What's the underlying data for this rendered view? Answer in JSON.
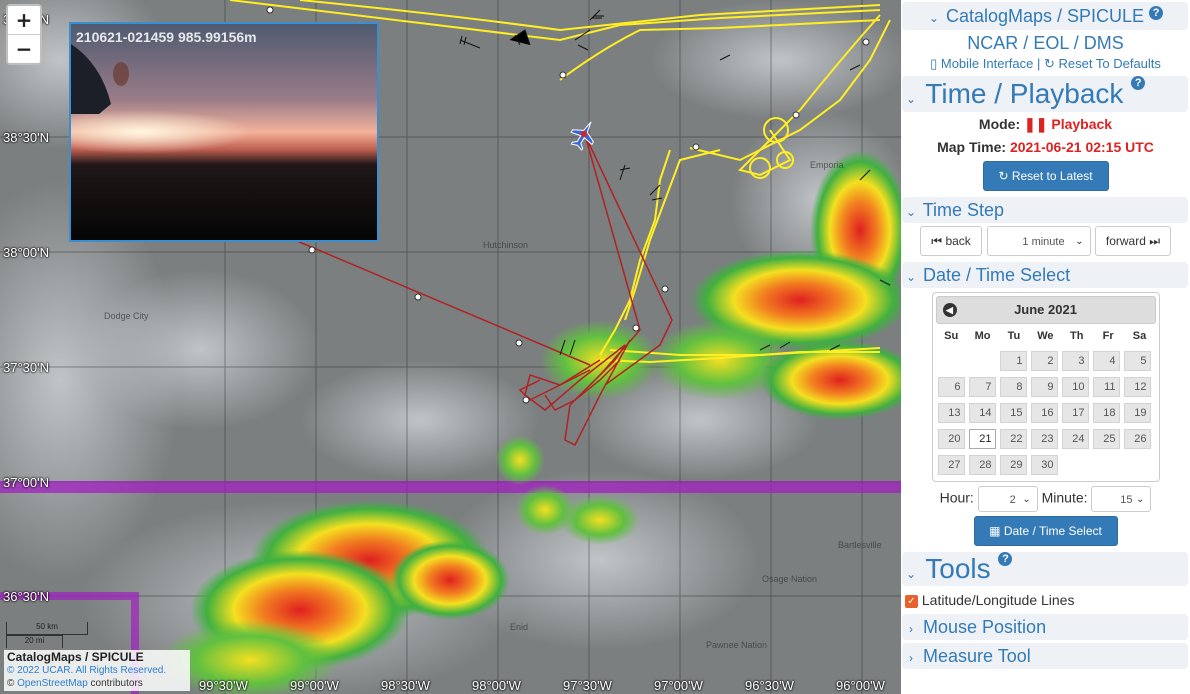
{
  "map": {
    "zoom_in": "+",
    "zoom_out": "−",
    "lat_labels": [
      "38°00'N",
      "38°30'N",
      "38°00'N",
      "37°30'N",
      "37°00'N",
      "36°30'N"
    ],
    "lon_labels": [
      "99°30'W",
      "99°00'W",
      "98°30'W",
      "98°00'W",
      "97°30'W",
      "97°00'W",
      "96°30'W",
      "96°00'W"
    ],
    "towns": [
      "Hutchinson",
      "Dodge City",
      "Emporia",
      "Bartlesville",
      "Osage Nation",
      "Enid",
      "Pawnee Nation"
    ],
    "photo_caption": "210621-021459 985.99156m",
    "scale_km": "50 km",
    "scale_mi": "20 mi",
    "attribution_title": "CatalogMaps / SPICULE",
    "attribution_copy": "© 2022 UCAR. All Rights Reserved.",
    "attribution_osm_prefix": "©",
    "attribution_osm": "OpenStreetMap",
    "attribution_osm_suffix": "contributors"
  },
  "panel": {
    "catalog_title": "CatalogMaps / SPICULE",
    "link_ncar": "NCAR",
    "link_eol": "EOL",
    "link_dms": "DMS",
    "link_sep": "/",
    "mobile": "Mobile Interface",
    "pipe": "|",
    "reset_defaults": "Reset To Defaults",
    "time_playback": "Time / Playback",
    "mode_label": "Mode:",
    "mode_value": "Playback",
    "map_time_label": "Map Time:",
    "map_time_value": "2021-06-21 02:15 UTC",
    "reset_latest": "Reset to Latest",
    "time_step": "Time Step",
    "back": "back",
    "step_value": "1 minute",
    "forward": "forward",
    "date_time_select": "Date / Time Select",
    "calendar_month": "June 2021",
    "dow": [
      "Su",
      "Mo",
      "Tu",
      "We",
      "Th",
      "Fr",
      "Sa"
    ],
    "days": [
      "",
      "",
      "1",
      "2",
      "3",
      "4",
      "5",
      "6",
      "7",
      "8",
      "9",
      "10",
      "11",
      "12",
      "13",
      "14",
      "15",
      "16",
      "17",
      "18",
      "19",
      "20",
      "21",
      "22",
      "23",
      "24",
      "25",
      "26",
      "27",
      "28",
      "29",
      "30"
    ],
    "selected_day": "21",
    "hour_label": "Hour:",
    "hour_value": "2",
    "minute_label": "Minute:",
    "minute_value": "15",
    "date_time_button": "Date / Time Select",
    "tools": "Tools",
    "latlon_lines": "Latitude/Longitude Lines",
    "mouse_position": "Mouse Position",
    "measure_tool": "Measure Tool"
  },
  "colors": {
    "accent": "#337ab7",
    "track_yellow": "#ffee22",
    "track_red": "#b22222",
    "playback_red": "#dd2222",
    "purple_band": "#a020c0"
  }
}
